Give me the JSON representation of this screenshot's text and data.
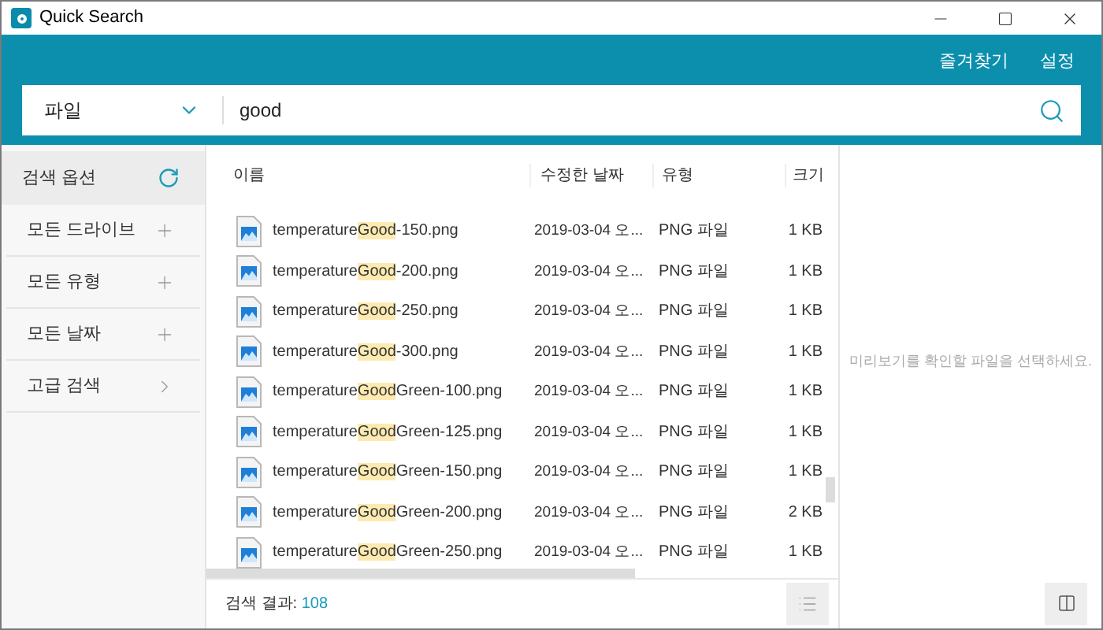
{
  "window": {
    "title": "Quick Search"
  },
  "header": {
    "links": [
      "즐겨찾기",
      "설정"
    ]
  },
  "search": {
    "scope": "파일",
    "value": "good"
  },
  "sidebar": {
    "items": [
      {
        "label": "검색 옵션",
        "kind": "refresh",
        "selected": true
      },
      {
        "label": "모든 드라이브",
        "kind": "expand",
        "selected": false
      },
      {
        "label": "모든 유형",
        "kind": "expand",
        "selected": false
      },
      {
        "label": "모든 날짜",
        "kind": "expand",
        "selected": false
      },
      {
        "label": "고급 검색",
        "kind": "more",
        "selected": false
      }
    ]
  },
  "table": {
    "columns": [
      "이름",
      "수정한 날짜",
      "유형",
      "크기"
    ],
    "rows": [
      {
        "name": [
          "temperature",
          "Good",
          "-150.png"
        ],
        "date": "2019-03-04 오...",
        "type": "PNG 파일",
        "size": "1 KB"
      },
      {
        "name": [
          "temperature",
          "Good",
          "-200.png"
        ],
        "date": "2019-03-04 오...",
        "type": "PNG 파일",
        "size": "1 KB"
      },
      {
        "name": [
          "temperature",
          "Good",
          "-250.png"
        ],
        "date": "2019-03-04 오...",
        "type": "PNG 파일",
        "size": "1 KB"
      },
      {
        "name": [
          "temperature",
          "Good",
          "-300.png"
        ],
        "date": "2019-03-04 오...",
        "type": "PNG 파일",
        "size": "1 KB"
      },
      {
        "name": [
          "temperature",
          "Good",
          "Green-100.png"
        ],
        "date": "2019-03-04 오...",
        "type": "PNG 파일",
        "size": "1 KB"
      },
      {
        "name": [
          "temperature",
          "Good",
          "Green-125.png"
        ],
        "date": "2019-03-04 오...",
        "type": "PNG 파일",
        "size": "1 KB"
      },
      {
        "name": [
          "temperature",
          "Good",
          "Green-150.png"
        ],
        "date": "2019-03-04 오...",
        "type": "PNG 파일",
        "size": "1 KB"
      },
      {
        "name": [
          "temperature",
          "Good",
          "Green-200.png"
        ],
        "date": "2019-03-04 오...",
        "type": "PNG 파일",
        "size": "2 KB"
      },
      {
        "name": [
          "temperature",
          "Good",
          "Green-250.png"
        ],
        "date": "2019-03-04 오...",
        "type": "PNG 파일",
        "size": "1 KB"
      }
    ]
  },
  "status_bar": {
    "label": "검색 결과:",
    "count": "108"
  },
  "preview": {
    "message": "미리보기를 확인할 파일을 선택하세요."
  }
}
